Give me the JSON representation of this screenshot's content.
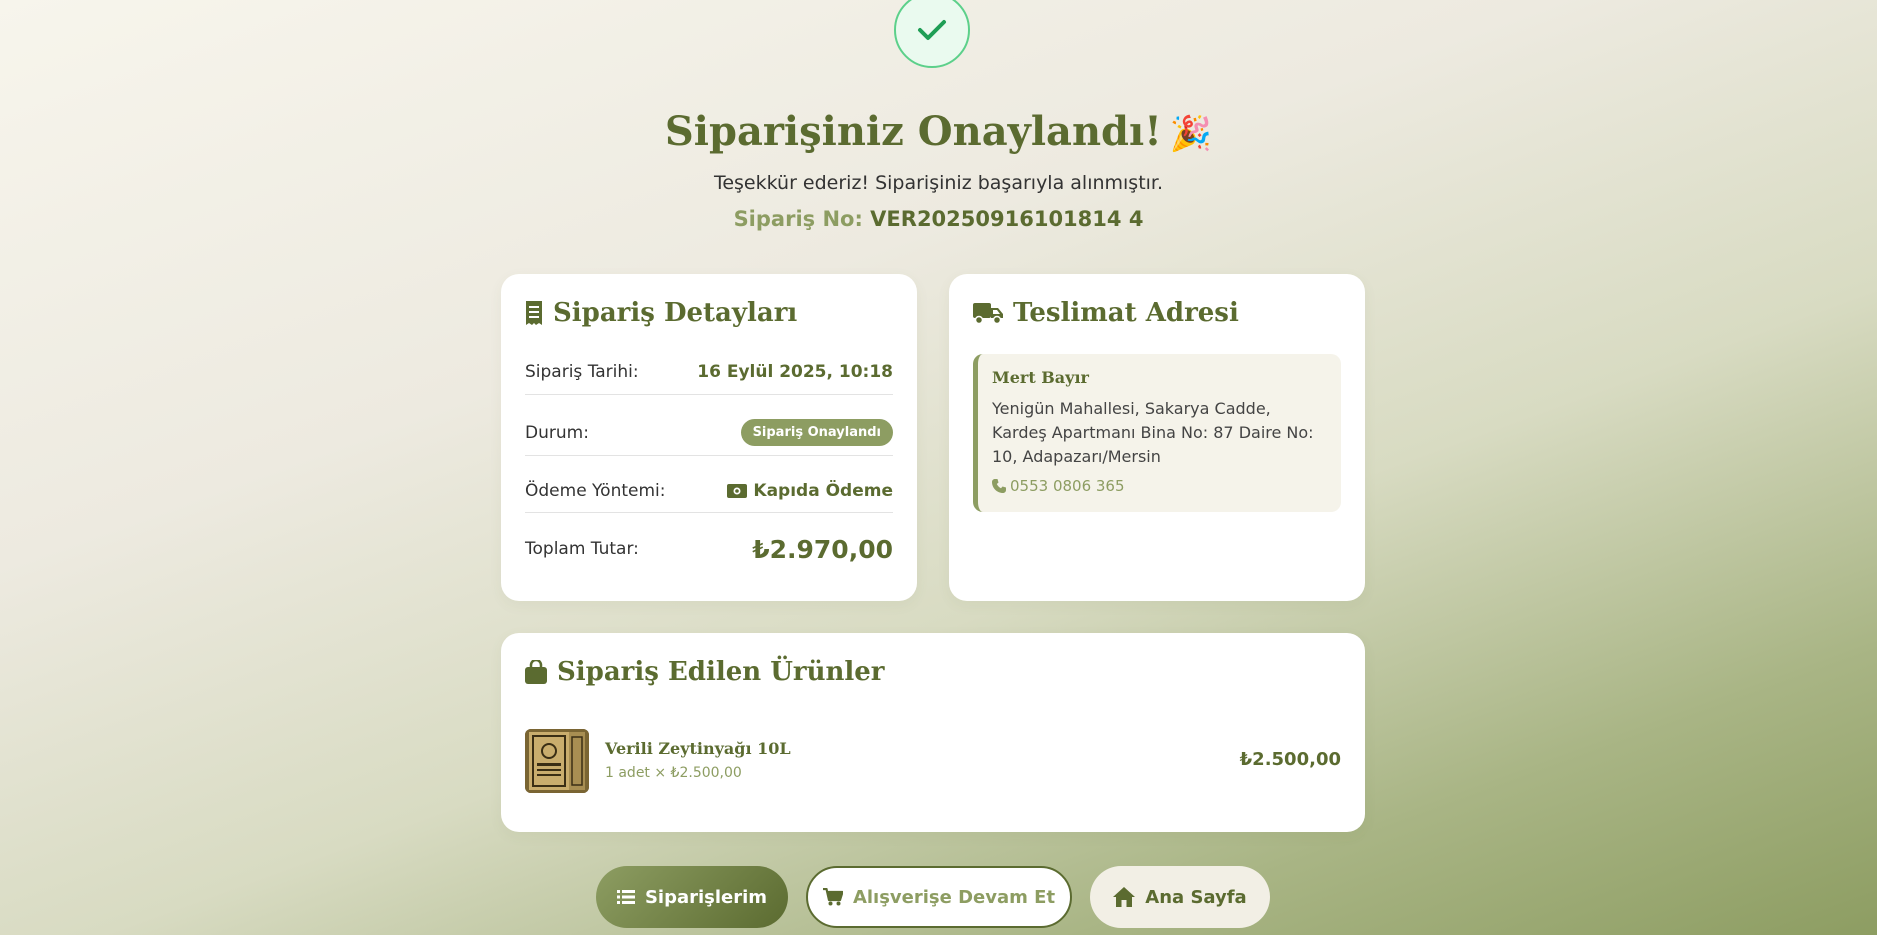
{
  "header": {
    "check_icon": "check-icon",
    "title": "Siparişiniz Onaylandı!",
    "party_emoji": "🎉",
    "subtitle": "Teşekkür ederiz! Siparişiniz başarıyla alınmıştır.",
    "order_no_label": "Sipariş No:",
    "order_no_value": "VER20250916101814 4"
  },
  "order_details": {
    "title": "Sipariş Detayları",
    "icon": "receipt-icon",
    "date_label": "Sipariş Tarihi:",
    "date_value": "16 Eylül 2025, 10:18",
    "status_label": "Durum:",
    "status_value": "Sipariş Onaylandı",
    "payment_label": "Ödeme Yöntemi:",
    "payment_icon": "money-icon",
    "payment_value": "Kapıda Ödeme",
    "total_label": "Toplam Tutar:",
    "total_value": "₺2.970,00"
  },
  "delivery": {
    "title": "Teslimat Adresi",
    "icon": "truck-icon",
    "name": "Mert Bayır",
    "address": "Yenigün Mahallesi, Sakarya Cadde, Kardeş Apartmanı Bina No: 87 Daire No: 10, Adapazarı/Mersin",
    "phone_icon": "phone-icon",
    "phone": "0553 0806 365"
  },
  "products": {
    "title": "Sipariş Edilen Ürünler",
    "icon": "shopping-bag-icon",
    "items": [
      {
        "name": "Verili Zeytinyağı 10L",
        "qty_text": "1 adet × ₺2.500,00",
        "price": "₺2.500,00"
      }
    ]
  },
  "actions": {
    "orders_label": "Siparişlerim",
    "orders_icon": "list-icon",
    "shop_label": "Alışverişe Devam Et",
    "shop_icon": "cart-icon",
    "home_label": "Ana Sayfa",
    "home_icon": "home-icon"
  },
  "colors": {
    "primary": "#5b6b30",
    "accent": "#8d9d62",
    "success": "#5cd08a"
  }
}
